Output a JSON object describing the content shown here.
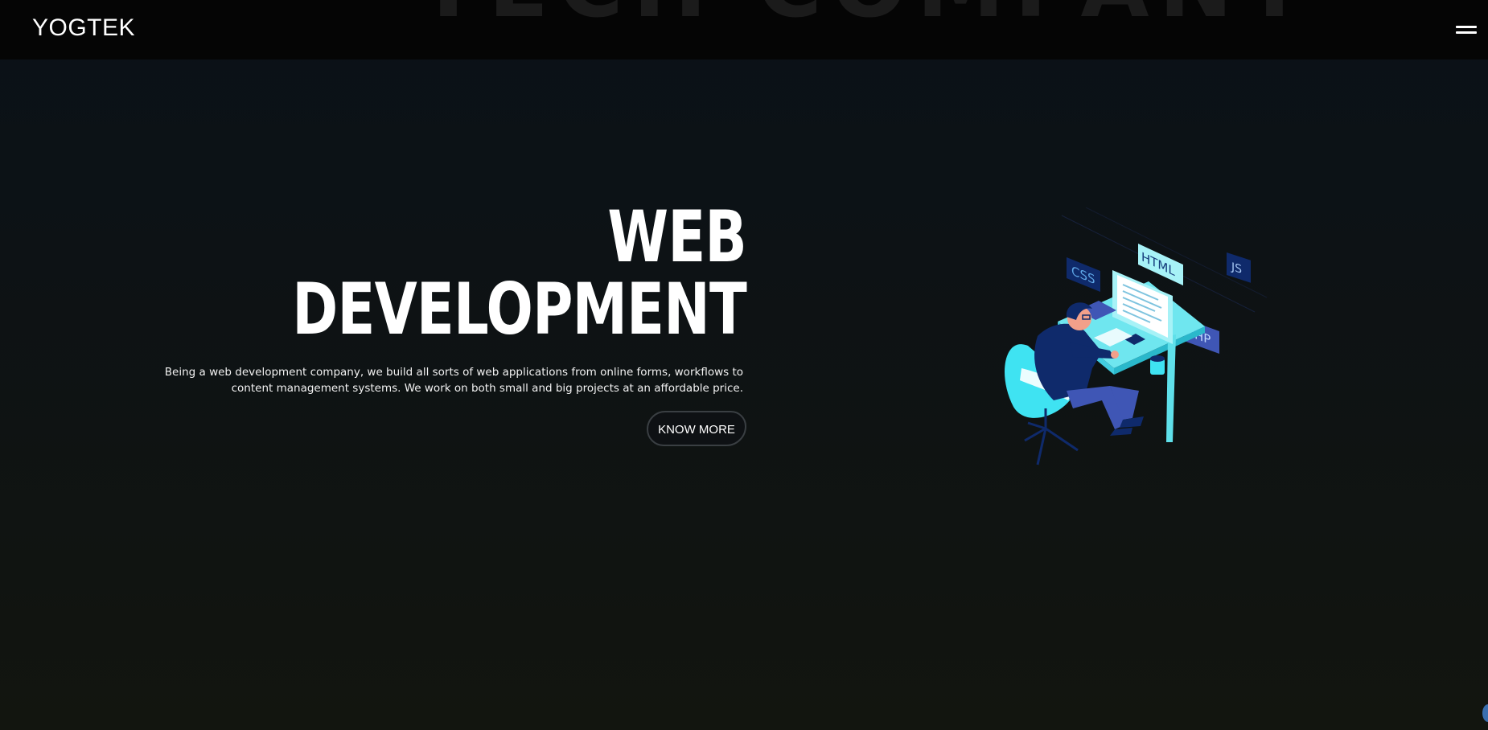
{
  "header": {
    "logo": "YOGTEK",
    "background_text": "TECH COMPANY",
    "menu_icon": "hamburger-menu-icon"
  },
  "hero": {
    "title_line1": "WEB",
    "title_line2": "DEVELOPMENT",
    "description_line1": "Being a web development company, we build all sorts of web applications from online forms, workflows to",
    "description_line2": "content management systems. We work on both small and big projects at an affordable price.",
    "cta_label": "KNOW MORE"
  },
  "illustration": {
    "tags": [
      "HTML",
      "CSS",
      "JS",
      "PHP"
    ]
  },
  "colors": {
    "accent_cyan": "#3fe3f2",
    "navy": "#0f2a6b",
    "mid_blue": "#3f56b5",
    "light_cyan": "#a7f2f7"
  }
}
